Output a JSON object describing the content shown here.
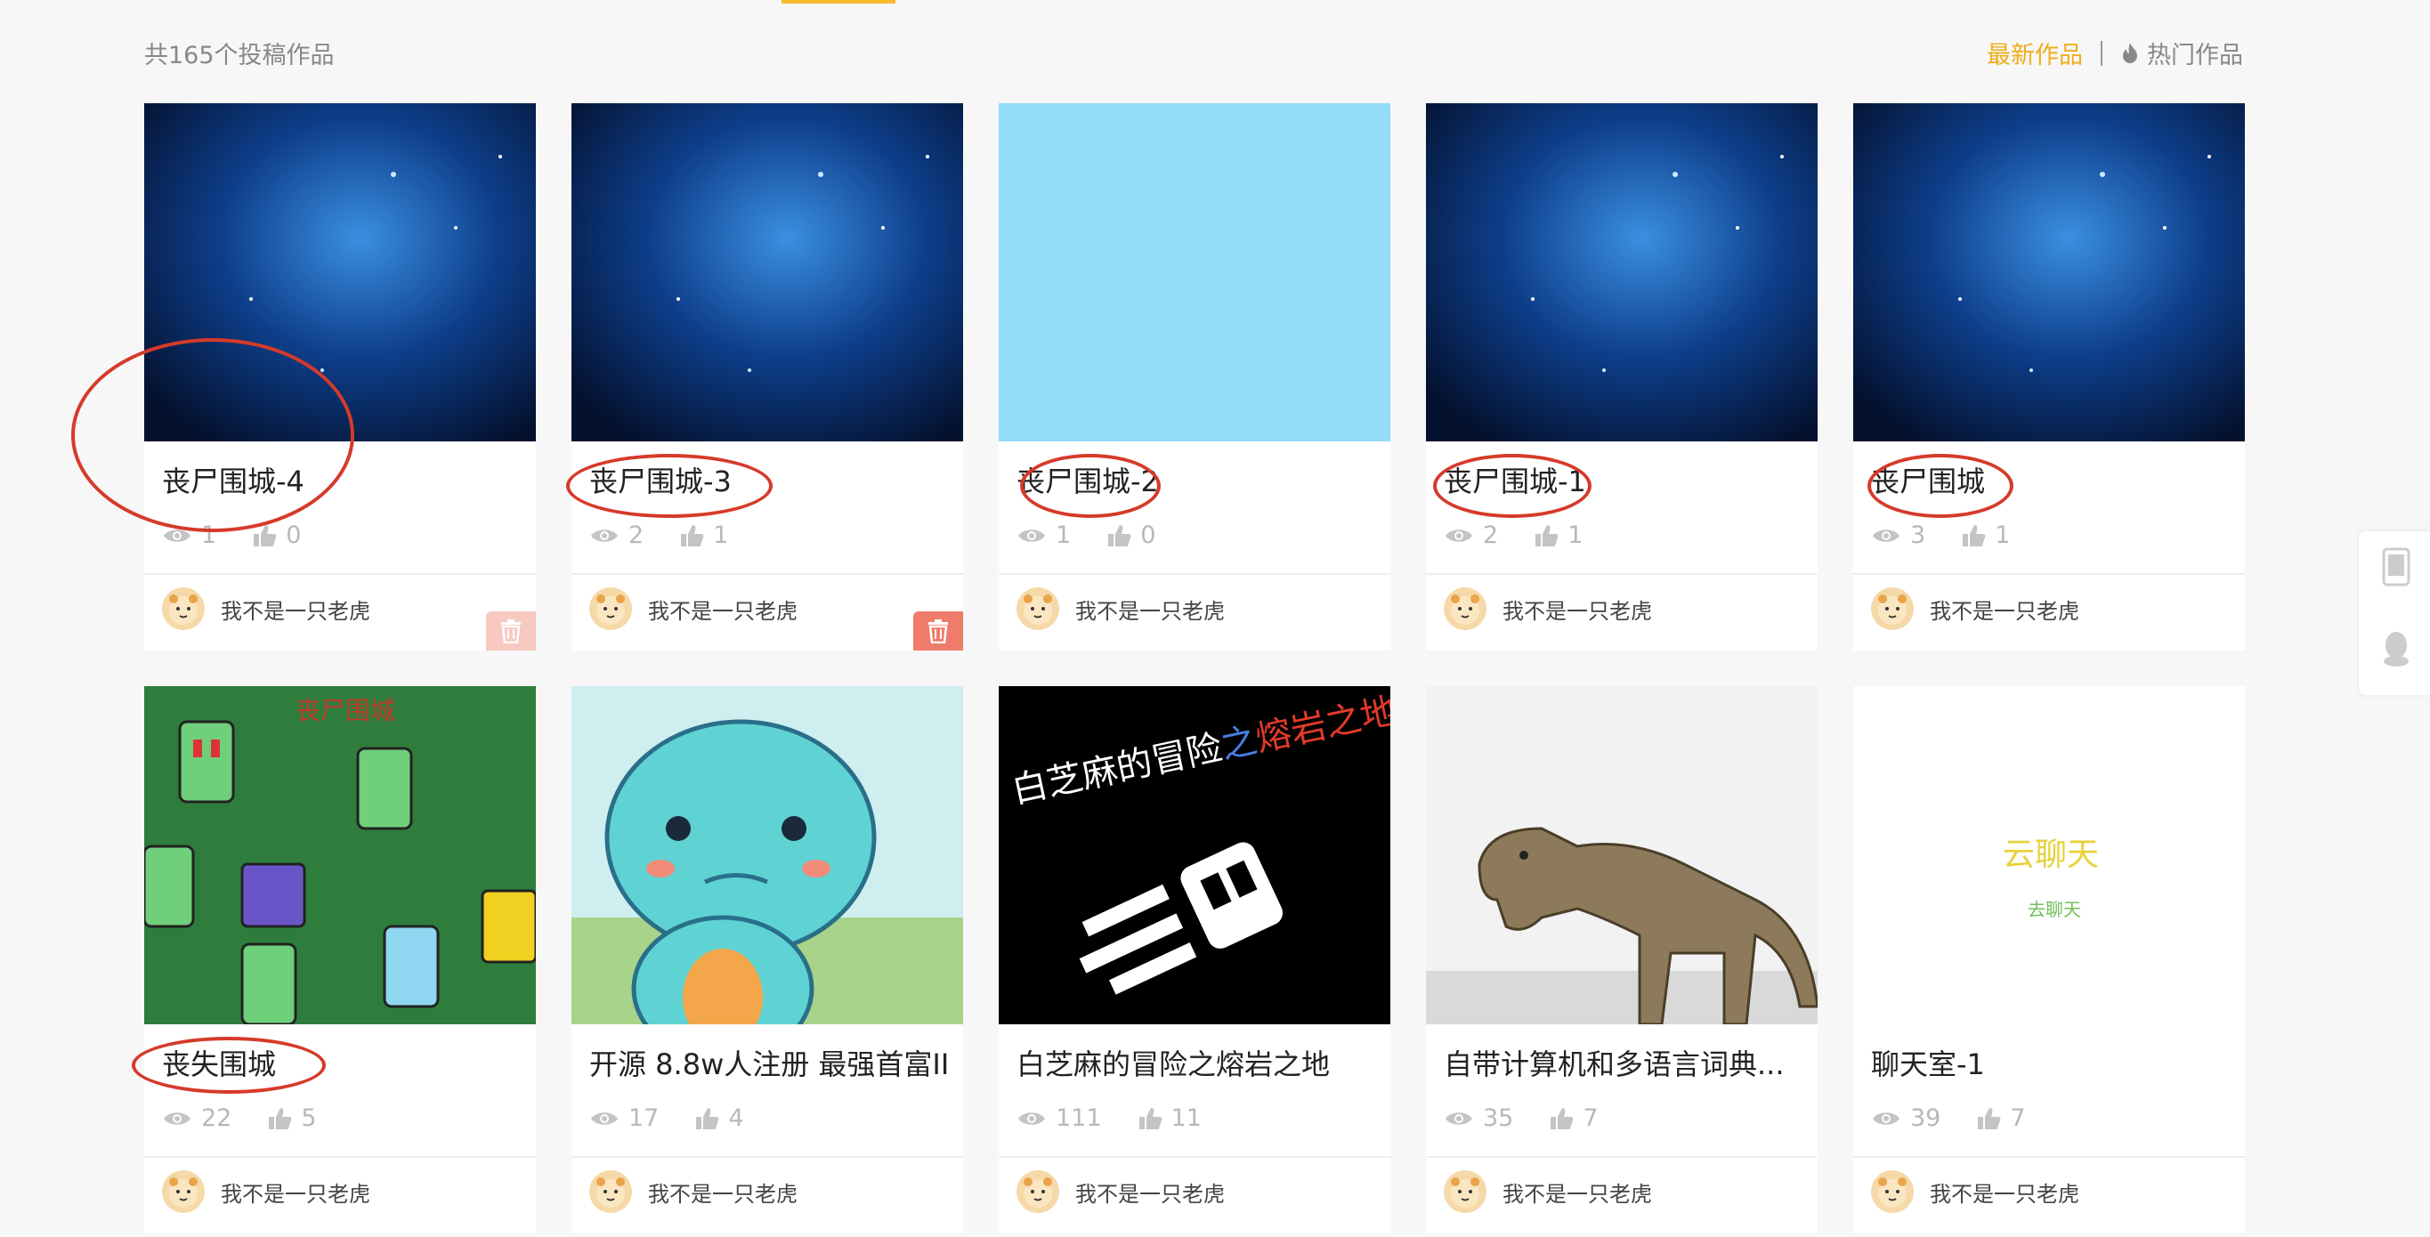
{
  "header": {
    "count_text": "共165个投稿作品",
    "sort_latest": "最新作品",
    "sort_hot": "热门作品",
    "accent_color": "#f0ad1a"
  },
  "cards": [
    {
      "title": "丧尸围城-4",
      "views": "1",
      "likes": "0",
      "author": "我不是一只老虎",
      "thumb": "space-icon",
      "delete": "faded"
    },
    {
      "title": "丧尸围城-3",
      "views": "2",
      "likes": "1",
      "author": "我不是一只老虎",
      "thumb": "space-icon",
      "delete": "solid"
    },
    {
      "title": "丧尸围城-2",
      "views": "1",
      "likes": "0",
      "author": "我不是一只老虎",
      "thumb": "sky-blue",
      "delete": "none"
    },
    {
      "title": "丧尸围城-1",
      "views": "2",
      "likes": "1",
      "author": "我不是一只老虎",
      "thumb": "space-icon",
      "delete": "none"
    },
    {
      "title": "丧尸围城",
      "views": "3",
      "likes": "1",
      "author": "我不是一只老虎",
      "thumb": "space-icon",
      "delete": "none"
    },
    {
      "title": "丧失围城",
      "views": "22",
      "likes": "5",
      "author": "我不是一只老虎",
      "thumb": "zombie-game-icon",
      "delete": "none",
      "thumb_text": "丧尸围城"
    },
    {
      "title": "开源 8.8w人注册 最强首富II",
      "views": "17",
      "likes": "4",
      "author": "我不是一只老虎",
      "thumb": "cartoon-fish-icon",
      "delete": "none"
    },
    {
      "title": "白芝麻的冒险之熔岩之地",
      "views": "111",
      "likes": "11",
      "author": "我不是一只老虎",
      "thumb": "lava-game-icon",
      "delete": "none",
      "thumb_text_a": "白芝麻的冒险",
      "thumb_text_b": "之",
      "thumb_text_c": "熔岩之地"
    },
    {
      "title": "自带计算机和多语言词典...",
      "views": "35",
      "likes": "7",
      "author": "我不是一只老虎",
      "thumb": "dinosaur-icon",
      "delete": "none"
    },
    {
      "title": "聊天室-1",
      "views": "39",
      "likes": "7",
      "author": "我不是一只老虎",
      "thumb": "chat-icon",
      "delete": "none",
      "thumb_text": "云聊天",
      "thumb_text_small": "去聊天"
    }
  ],
  "side": {
    "phone": "phone-icon",
    "qq": "qq-icon"
  }
}
